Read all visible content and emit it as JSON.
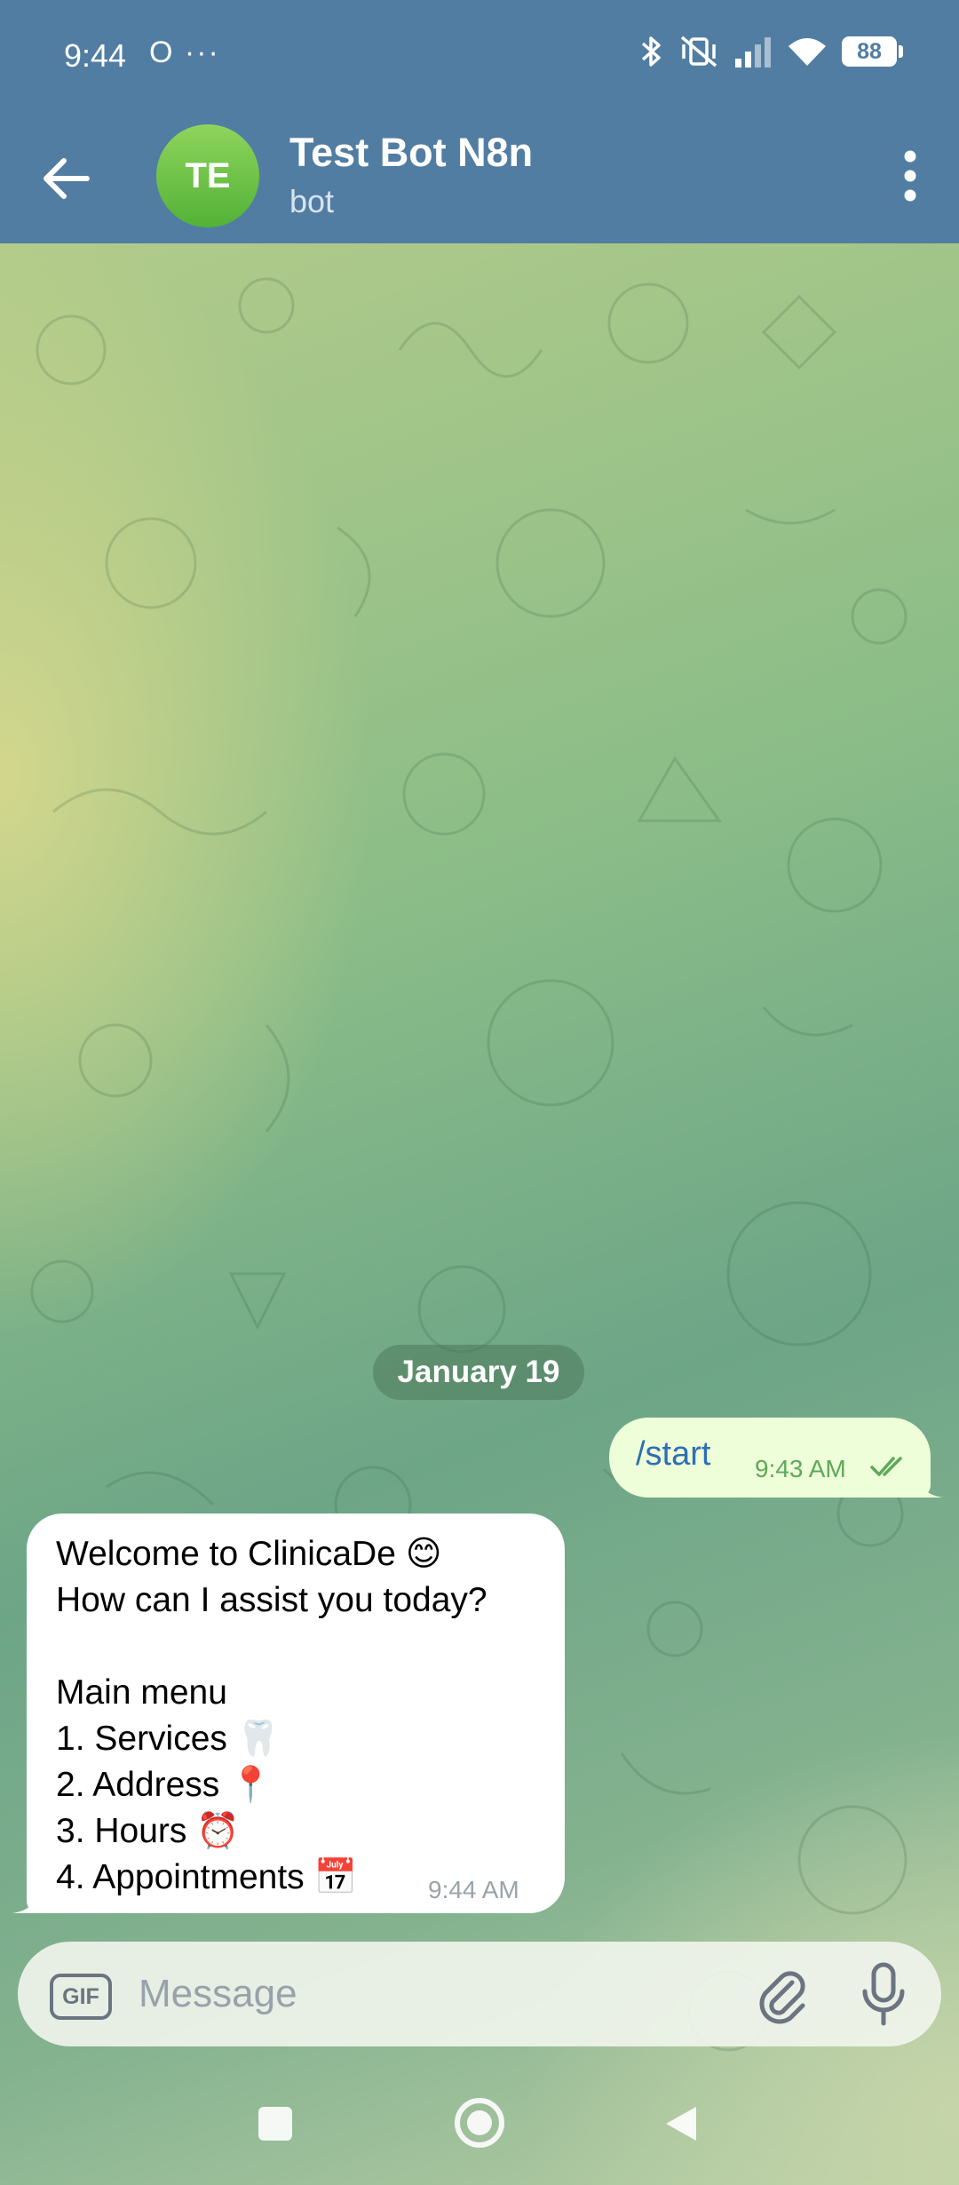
{
  "status_bar": {
    "time": "9:44",
    "left_icons": "O ···",
    "battery": "88",
    "icons": [
      "bluetooth-icon",
      "vibrate-off-icon",
      "signal-icon",
      "wifi-icon",
      "battery-icon"
    ]
  },
  "header": {
    "avatar_initials": "TE",
    "title": "Test Bot N8n",
    "subtitle": "bot",
    "back_icon": "arrow-left-icon",
    "menu_icon": "more-vertical-icon"
  },
  "chat": {
    "date_separator": "January 19",
    "outgoing": {
      "text": "/start",
      "time": "9:43 AM",
      "status_icon": "double-check-icon"
    },
    "incoming": {
      "lines": [
        "Welcome to ClinicaDe 😊",
        "How can I assist you today?",
        "",
        "Main menu",
        "1. Services 🦷",
        "2. Address 📍",
        "3. Hours ⏰",
        "4. Appointments 📅"
      ],
      "time": "9:44 AM"
    }
  },
  "input": {
    "gif_label": "GIF",
    "placeholder": "Message",
    "value": ""
  },
  "colors": {
    "header": "#517da2",
    "outgoing_bubble": "#eefed9",
    "incoming_bubble": "#ffffff",
    "outgoing_text": "#2d6fb3",
    "tick_green": "#5fa85a"
  }
}
